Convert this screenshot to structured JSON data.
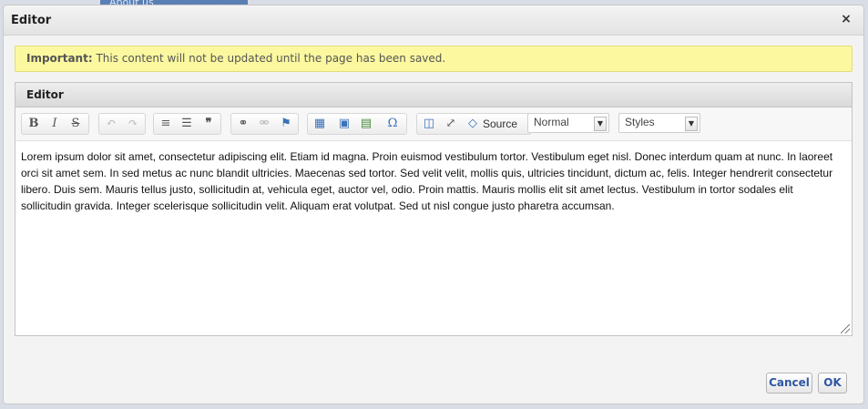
{
  "background": {
    "nav_item": "About us"
  },
  "dialog": {
    "title": "Editor",
    "close_glyph": "×",
    "notice": {
      "label": "Important:",
      "text": " This content will not be updated until the page has been saved."
    },
    "editor": {
      "header": "Editor",
      "toolbar": {
        "bold": "B",
        "italic": "I",
        "strike": "S",
        "undo": "↶",
        "redo": "↷",
        "numbered_list": "≡",
        "bulleted_list": "☰",
        "blockquote": "❞",
        "link": "⚭",
        "unlink": "⚮",
        "anchor": "⚑",
        "table": "▦",
        "image": "▣",
        "gallery": "▤",
        "special_char": "Ω",
        "show_blocks": "◫",
        "maximize": "⤢",
        "source_icon": "◇",
        "source_label": "Source",
        "format_select": "Normal",
        "styles_select": "Styles",
        "dropdown_glyph": "▼"
      },
      "content": "Lorem ipsum dolor sit amet, consectetur adipiscing elit. Etiam id magna. Proin euismod vestibulum tortor. Vestibulum eget nisl. Donec interdum quam at nunc. In laoreet orci sit amet sem. In sed metus ac nunc blandit ultricies. Maecenas sed tortor. Sed velit velit, mollis quis, ultricies tincidunt, dictum ac, felis. Integer hendrerit consectetur libero. Duis sem. Mauris tellus justo, sollicitudin at, vehicula eget, auctor vel, odio. Proin mattis. Mauris mollis elit sit amet lectus. Vestibulum in tortor sodales elit sollicitudin gravida. Integer scelerisque sollicitudin velit. Aliquam erat volutpat. Sed ut nisl congue justo pharetra accumsan."
    },
    "buttons": {
      "cancel": "Cancel",
      "ok": "OK"
    }
  },
  "colors": {
    "notice_bg": "#fbf8a0",
    "button_text": "#2e57a3"
  }
}
